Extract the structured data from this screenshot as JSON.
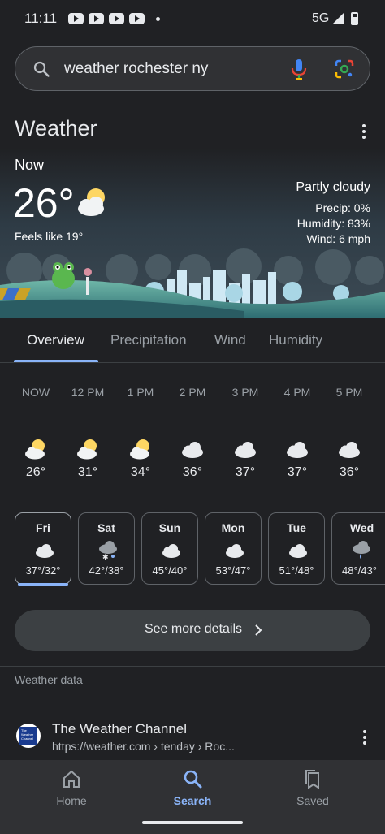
{
  "status_bar": {
    "time": "11:11",
    "network": "5G"
  },
  "search": {
    "query": "weather rochester ny"
  },
  "weather": {
    "title": "Weather",
    "now_label": "Now",
    "temperature": "26°",
    "feels_like": "Feels like 19°",
    "condition": "Partly cloudy",
    "precip": "Precip: 0%",
    "humidity": "Humidity: 83%",
    "wind": "Wind: 6 mph",
    "tabs": [
      {
        "label": "Overview",
        "active": true
      },
      {
        "label": "Precipitation",
        "active": false
      },
      {
        "label": "Wind",
        "active": false
      },
      {
        "label": "Humidity",
        "active": false
      }
    ],
    "hourly": [
      {
        "time": "NOW",
        "temp": "26°",
        "icon": "partly-cloudy-icon"
      },
      {
        "time": "12 PM",
        "temp": "31°",
        "icon": "partly-cloudy-icon"
      },
      {
        "time": "1 PM",
        "temp": "34°",
        "icon": "partly-cloudy-icon"
      },
      {
        "time": "2 PM",
        "temp": "36°",
        "icon": "cloudy-icon"
      },
      {
        "time": "3 PM",
        "temp": "37°",
        "icon": "cloudy-icon"
      },
      {
        "time": "4 PM",
        "temp": "37°",
        "icon": "cloudy-icon"
      },
      {
        "time": "5 PM",
        "temp": "36°",
        "icon": "cloudy-icon"
      }
    ],
    "daily": [
      {
        "day": "Fri",
        "range": "37°/32°",
        "icon": "cloudy-icon",
        "selected": true
      },
      {
        "day": "Sat",
        "range": "42°/38°",
        "icon": "snow-showers-icon",
        "selected": false
      },
      {
        "day": "Sun",
        "range": "45°/40°",
        "icon": "cloudy-icon",
        "selected": false
      },
      {
        "day": "Mon",
        "range": "53°/47°",
        "icon": "cloudy-icon",
        "selected": false
      },
      {
        "day": "Tue",
        "range": "51°/48°",
        "icon": "cloudy-icon",
        "selected": false
      },
      {
        "day": "Wed",
        "range": "48°/43°",
        "icon": "rain-icon",
        "selected": false
      }
    ],
    "see_more": "See more details",
    "data_link": "Weather data"
  },
  "result": {
    "logo_text": "The Weather Channel",
    "title": "The Weather Channel",
    "url": "https://weather.com › tenday › Roc..."
  },
  "nav": [
    {
      "label": "Home",
      "icon": "home-icon",
      "active": false
    },
    {
      "label": "Search",
      "icon": "search-icon",
      "active": true
    },
    {
      "label": "Saved",
      "icon": "bookmarks-icon",
      "active": false
    }
  ],
  "colors": {
    "accent": "#8ab4f8",
    "background": "#202124",
    "surface": "#303134",
    "sun": "#fdd663"
  }
}
